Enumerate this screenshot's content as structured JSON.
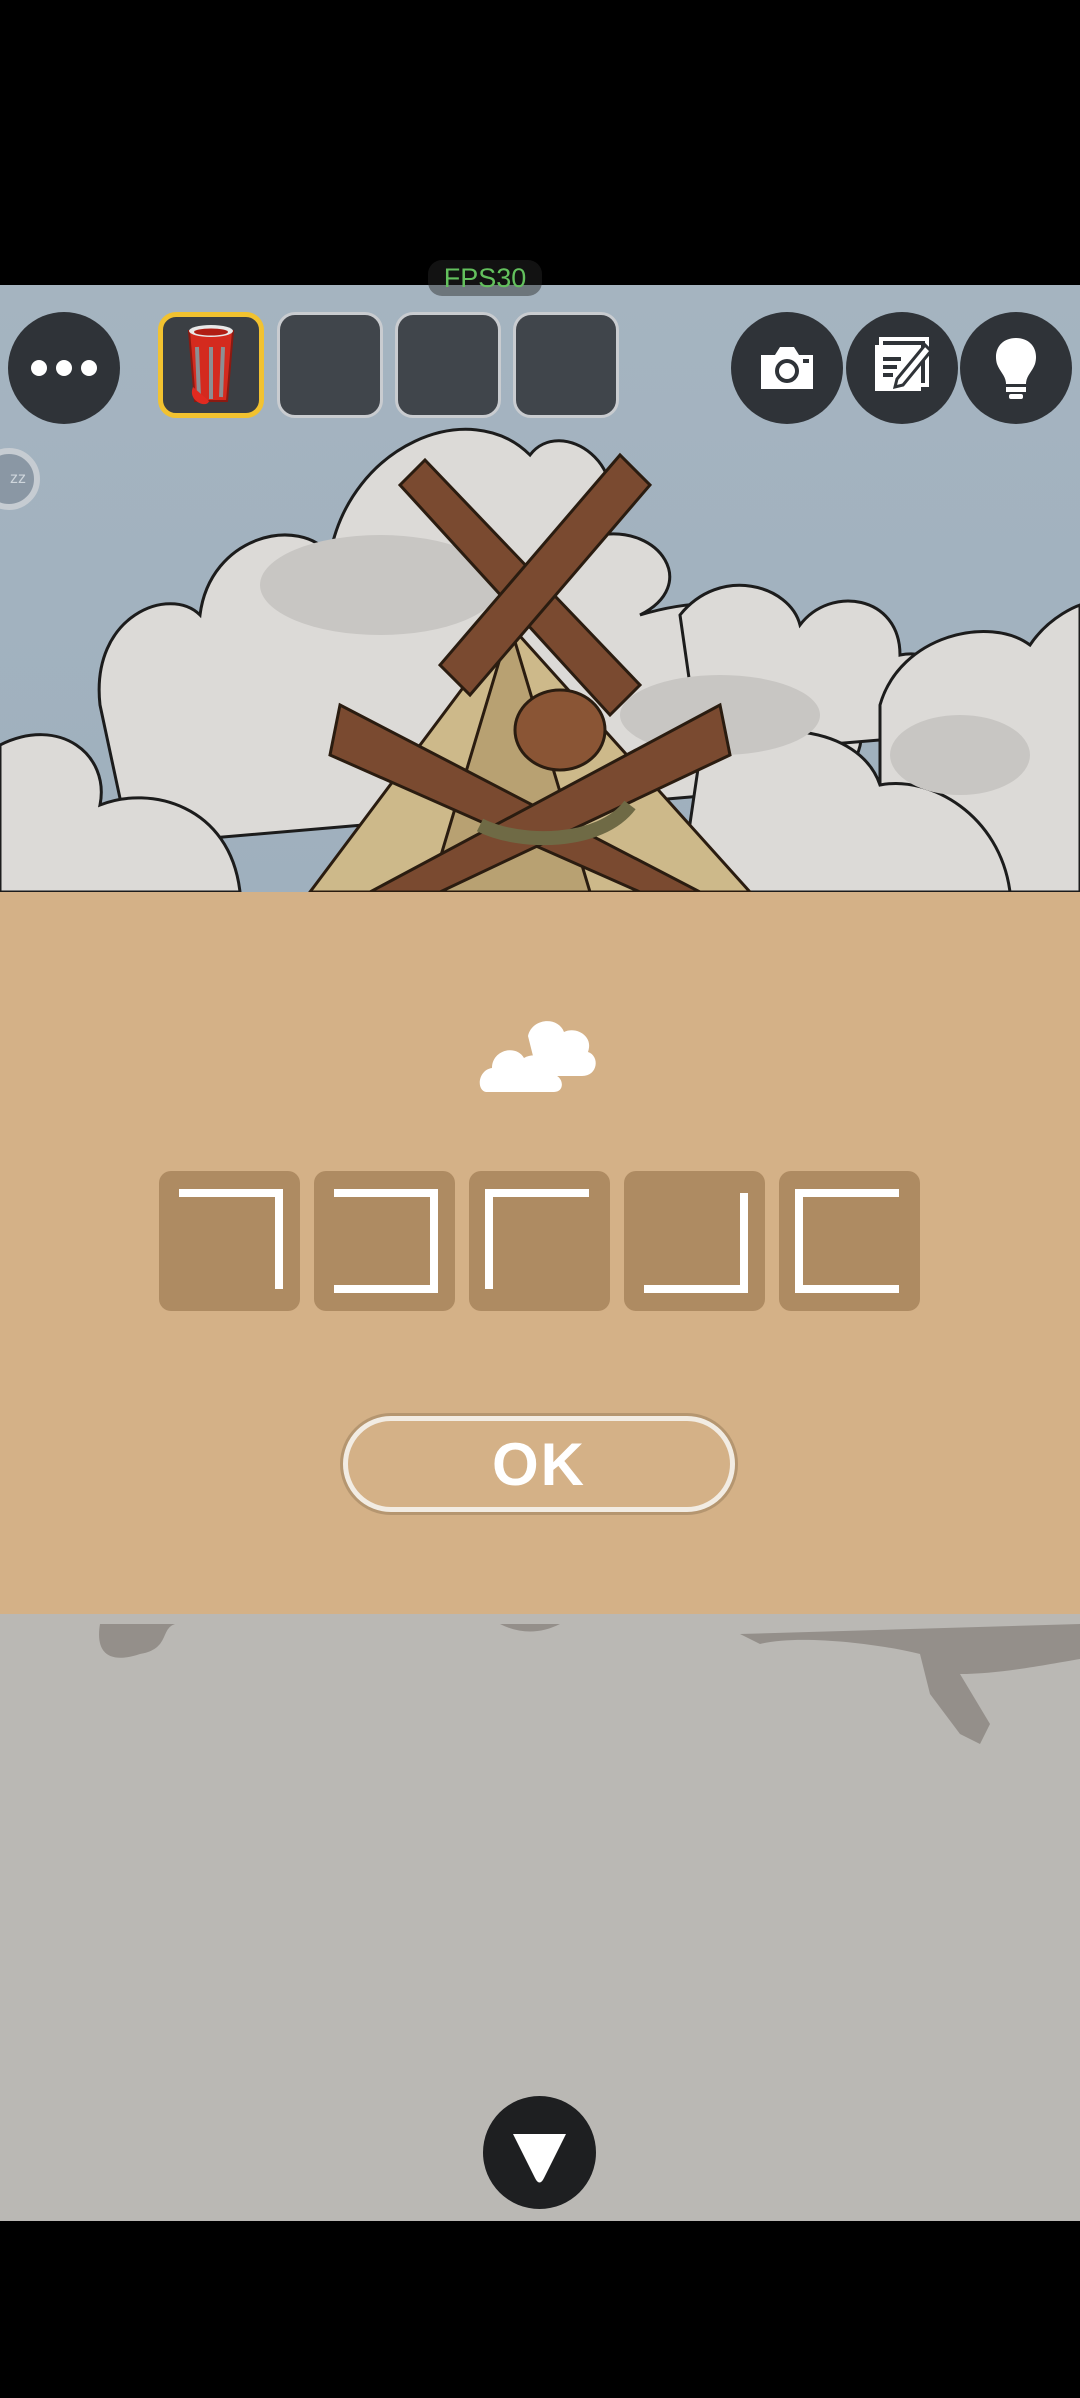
{
  "fps": {
    "label": "FPS30"
  },
  "toolbar": {
    "menu_icon": "more-dots-icon",
    "camera_icon": "camera-icon",
    "memo_icon": "memo-pencil-icon",
    "hint_icon": "lightbulb-icon"
  },
  "inventory": {
    "selected_index": 0,
    "slots": [
      {
        "item": "red-paint-cup-icon"
      },
      {
        "item": ""
      },
      {
        "item": ""
      },
      {
        "item": ""
      }
    ]
  },
  "puzzle": {
    "clue_icon": "clouds-icon",
    "tiles": [
      "top-right-bracket",
      "right-bracket",
      "top-left-bracket",
      "bottom-right-bracket",
      "left-bracket"
    ],
    "ok_label": "OK"
  },
  "navigation": {
    "down_icon": "down-arrow-icon"
  },
  "colors": {
    "panel": "#d4b187",
    "tile": "#ae8b62",
    "selected_slot_border": "#f2c230",
    "fps_text": "#63c05d"
  }
}
